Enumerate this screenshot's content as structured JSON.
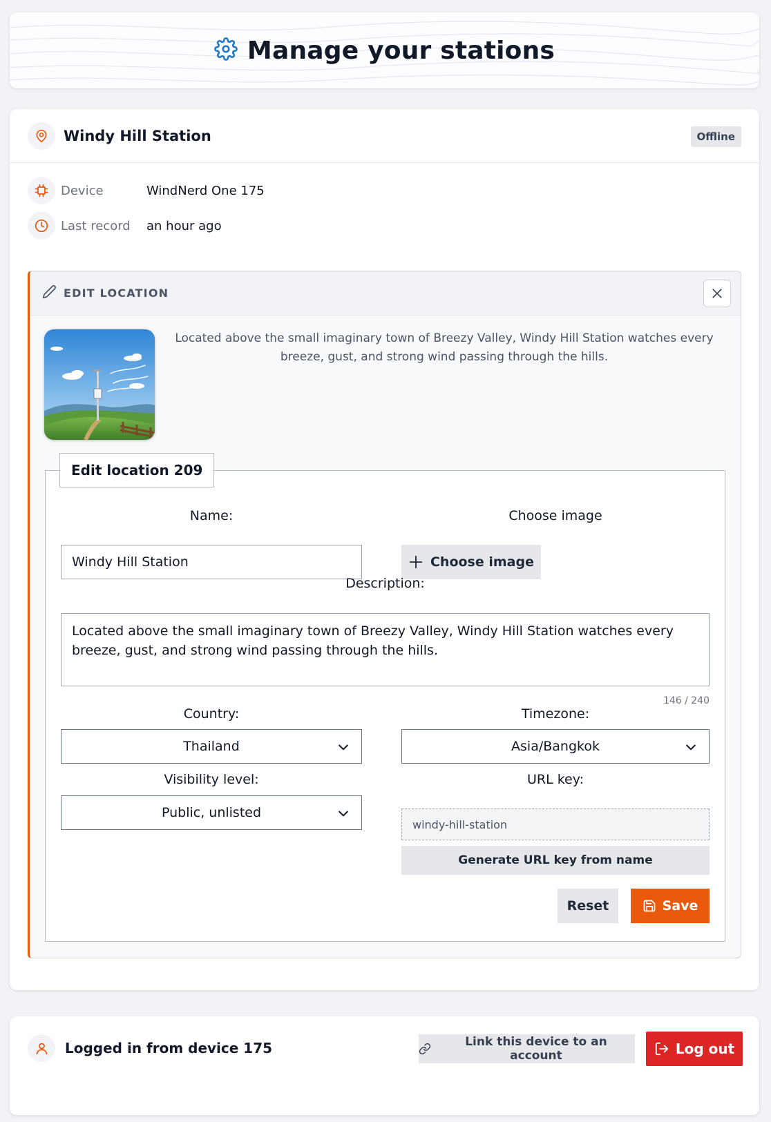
{
  "header": {
    "title": "Manage your stations",
    "icon": "gear-icon"
  },
  "station": {
    "name": "Windy Hill Station",
    "status": "Offline",
    "device_label": "Device",
    "device_value": "WindNerd One 175",
    "last_record_label": "Last record",
    "last_record_value": "an hour ago"
  },
  "edit_panel": {
    "heading": "EDIT LOCATION",
    "description_preview": "Located above the small imaginary town of Breezy Valley, Windy Hill Station watches every breeze, gust, and strong wind passing through the hills.",
    "form": {
      "legend": "Edit location 209",
      "name_label": "Name:",
      "name_value": "Windy Hill Station",
      "image_label": "Choose image",
      "image_button": "Choose image",
      "description_label": "Description:",
      "description_value": "Located above the small imaginary town of Breezy Valley, Windy Hill Station watches every breeze, gust, and strong wind passing through the hills.",
      "char_counter": "146 / 240",
      "country_label": "Country:",
      "country_value": "Thailand",
      "timezone_label": "Timezone:",
      "timezone_value": "Asia/Bangkok",
      "visibility_label": "Visibility level:",
      "visibility_value": "Public, unlisted",
      "url_key_label": "URL key:",
      "url_key_value": "windy-hill-station",
      "generate_button": "Generate URL key from name",
      "reset_button": "Reset",
      "save_button": "Save"
    }
  },
  "footer": {
    "logged_in_text": "Logged in from device 175",
    "link_button": "Link this device to an account",
    "logout_button": "Log out"
  },
  "colors": {
    "accent": "#ea580c",
    "danger": "#dc2626",
    "header_icon": "#1d76c9",
    "neutral_button": "#e5e7eb"
  }
}
